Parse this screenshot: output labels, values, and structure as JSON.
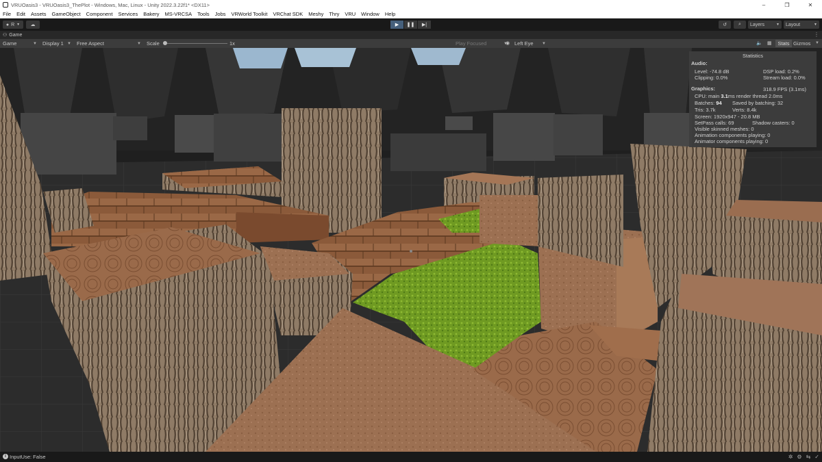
{
  "window": {
    "title": "VRUOasis3 - VRUOasis3_ThePlot - Windows, Mac, Linux - Unity 2022.3.22f1* <DX11>",
    "buttons": [
      "–",
      "❐",
      "✕"
    ]
  },
  "menu": [
    "File",
    "Edit",
    "Assets",
    "GameObject",
    "Component",
    "Services",
    "Bakery",
    "MS-VRCSA",
    "Tools",
    "Jobs",
    "VRWorld Toolkit",
    "VRChat SDK",
    "Meshy",
    "Thry",
    "VRU",
    "Window",
    "Help"
  ],
  "toolbar": {
    "account_label": "R",
    "layers_label": "Layers",
    "layout_label": "Layout"
  },
  "tab": {
    "label": "Game"
  },
  "game_toolbar": {
    "mode": "Game",
    "display": "Display 1",
    "aspect": "Free Aspect",
    "scale_label": "Scale",
    "scale_value": "1x",
    "scale_fraction": 0,
    "play_focused": "Play Focused",
    "eye": "Left Eye",
    "stats": "Stats",
    "gizmos": "Gizmos"
  },
  "stats": {
    "title": "Statistics",
    "audio_header": "Audio:",
    "level": "Level: -74.8 dB",
    "clipping": "Clipping: 0.0%",
    "dsp": "DSP load: 0.2%",
    "stream": "Stream load: 0.0%",
    "graphics_header": "Graphics:",
    "fps": "318.9 FPS (3.1ms)",
    "cpu_prefix": "CPU: main ",
    "cpu_main": "3.1",
    "cpu_suffix": "ms  render thread 2.0ms",
    "batches_prefix": "Batches: ",
    "batches": "94",
    "saved_batching": "Saved by batching: 32",
    "tris": "Tris: 3.7k",
    "verts": "Verts: 8.4k",
    "screen": "Screen: 1920x947 - 20.8 MB",
    "setpass": "SetPass calls: 69",
    "shadow": "Shadow casters: 0",
    "skinned": "Visible skinned meshes: 0",
    "animation": "Animation components playing: 0",
    "animator": "Animator components playing: 0"
  },
  "status": {
    "text": "InputUse: False"
  },
  "colors": {
    "play_active": "#46607c",
    "editor_bg": "#3c3c3c",
    "grass": "#6f9a22",
    "wood": "#8b5a3a",
    "bark": "#8f7a63"
  }
}
